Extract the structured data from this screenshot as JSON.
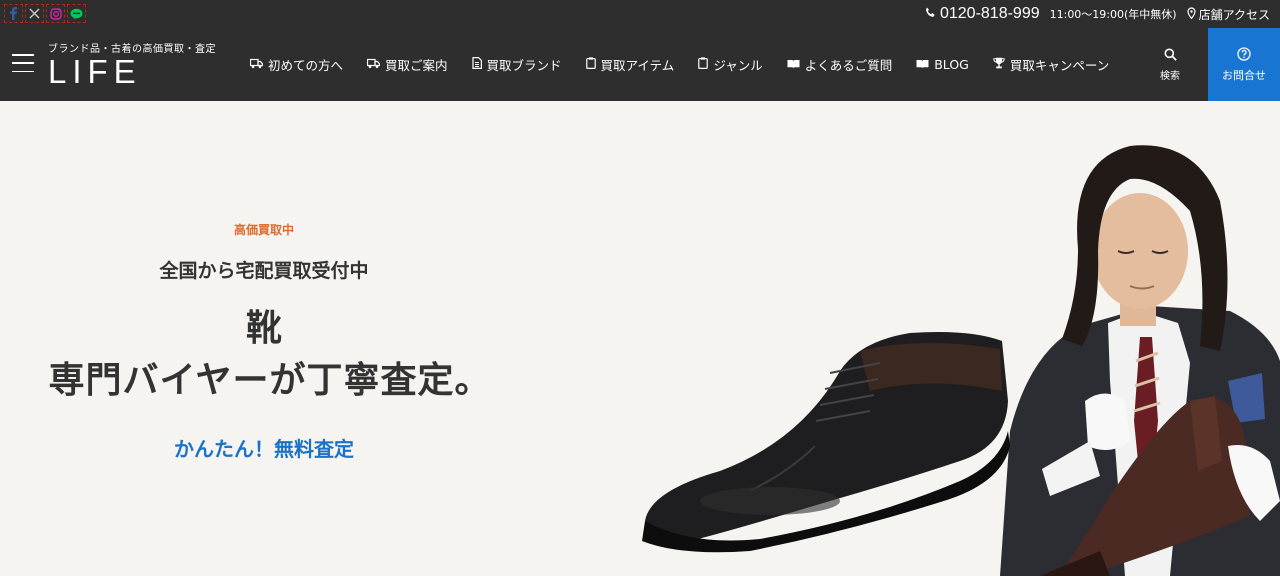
{
  "social": {
    "facebook": "facebook-icon",
    "x": "x-icon",
    "instagram": "instagram-icon",
    "line": "line-icon"
  },
  "contact": {
    "phone": "0120-818-999",
    "hours": "11:00〜19:00(年中無休)",
    "access": "店舗アクセス"
  },
  "logo": {
    "tagline": "ブランド品・古着の高価買取・査定",
    "name": "LIFE"
  },
  "nav": [
    {
      "label": "初めての方へ",
      "icon": "truck-icon"
    },
    {
      "label": "買取ご案内",
      "icon": "truck-icon"
    },
    {
      "label": "買取ブランド",
      "icon": "document-icon"
    },
    {
      "label": "買取アイテム",
      "icon": "clipboard-icon"
    },
    {
      "label": "ジャンル",
      "icon": "clipboard-icon"
    },
    {
      "label": "よくあるご質問",
      "icon": "book-icon"
    },
    {
      "label": "BLOG",
      "icon": "book-icon"
    },
    {
      "label": "買取キャンペーン",
      "icon": "trophy-icon"
    }
  ],
  "search": {
    "label": "検索"
  },
  "inquiry": {
    "label": "お問合せ"
  },
  "hero": {
    "badge": "高価買取中",
    "subhead": "全国から宅配買取受付中",
    "headline_1": "靴",
    "headline_2": "専門バイヤーが丁寧査定。",
    "cta": "かんたん！無料査定"
  },
  "colors": {
    "header_bg": "#2e2e2e",
    "accent_blue": "#1975d2",
    "badge_orange": "#e06a2c",
    "hero_bg": "#f5f4f1"
  }
}
